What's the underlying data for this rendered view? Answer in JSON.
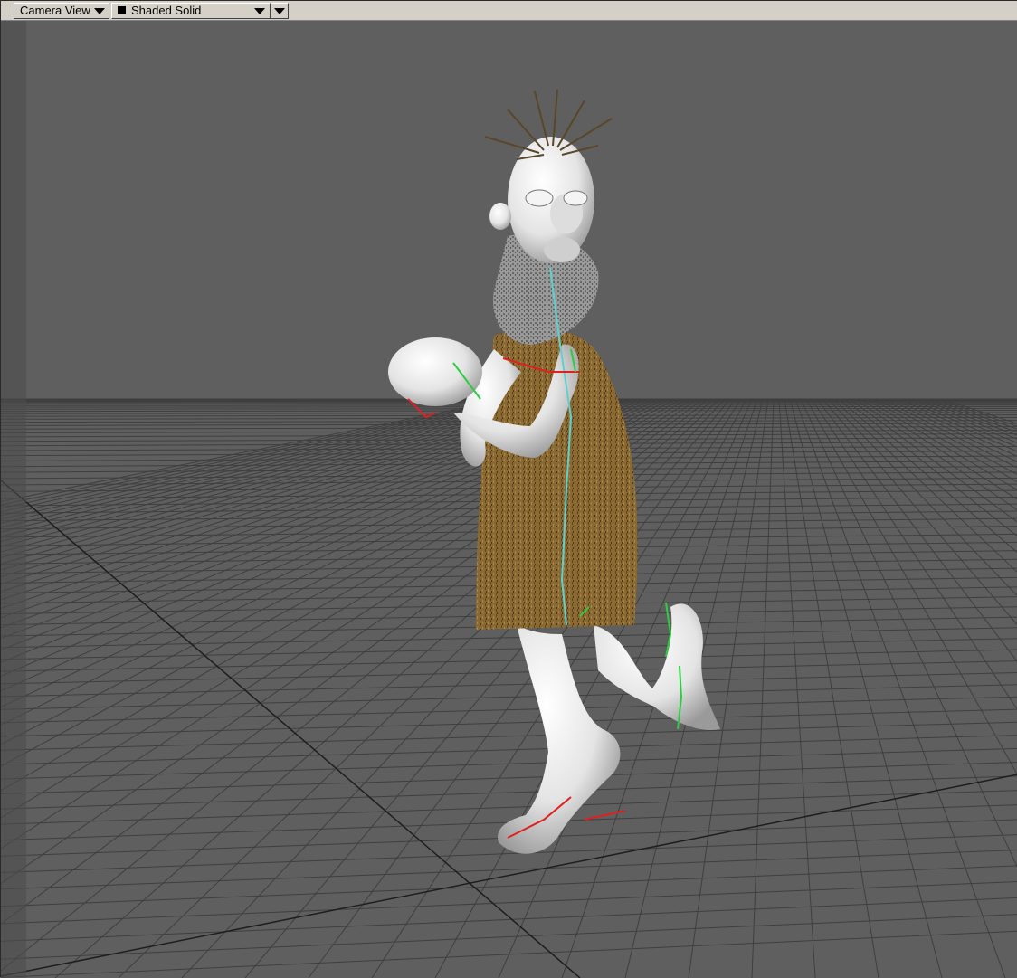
{
  "viewport_header": {
    "view_label": "Camera View",
    "view_icon": "chevron-down-icon",
    "shading_label": "Shaded Solid",
    "shading_icon": "square-swatch-icon",
    "shading_swatch_color": "#000000",
    "extra_menu_icon": "chevron-down-icon"
  },
  "scene": {
    "background_color": "#5f5f5f",
    "grid_color": "#3f3f3f",
    "skin_color": "#f2f2f2",
    "tunic_color": "#8a6a32",
    "hair_color": "#5a4628",
    "bone_colors": {
      "green": "#2ecc40",
      "red": "#e02020",
      "cyan": "#5fd0d0"
    }
  }
}
